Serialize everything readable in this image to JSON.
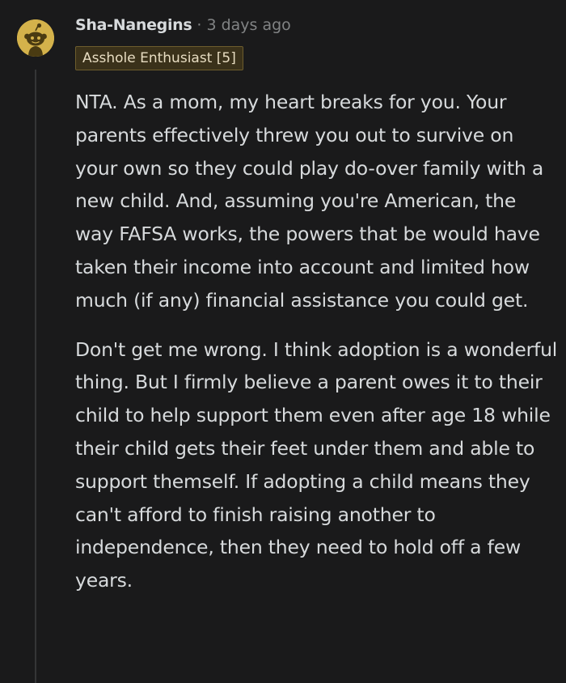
{
  "comment": {
    "author": "Sha-Nanegins",
    "separator": "·",
    "timestamp": "3 days ago",
    "flair": "Asshole Enthusiast [5]",
    "avatar_icon": "snoo-avatar-icon",
    "colors": {
      "background": "#1a1a1b",
      "text": "#d7dadc",
      "meta": "#818384",
      "avatar": "#d4b24b",
      "flair_bg": "#3a311a",
      "flair_text": "#e7dcc1"
    },
    "paragraphs": [
      "NTA. As a mom, my heart breaks for you. Your parents effectively threw you out to survive on your own so they could play do-over family with a new child. And, assuming you're American, the way FAFSA works, the powers that be would have taken their income into account and limited how much (if any) financial assistance you could get.",
      "Don't get me wrong. I think adoption is a wonderful thing. But I firmly believe a parent owes it to their child to help support them even after age 18 while their child gets their feet under them and able to support themself. If adopting a child means they can't afford to finish raising another to independence, then they need to hold off a few years."
    ]
  }
}
